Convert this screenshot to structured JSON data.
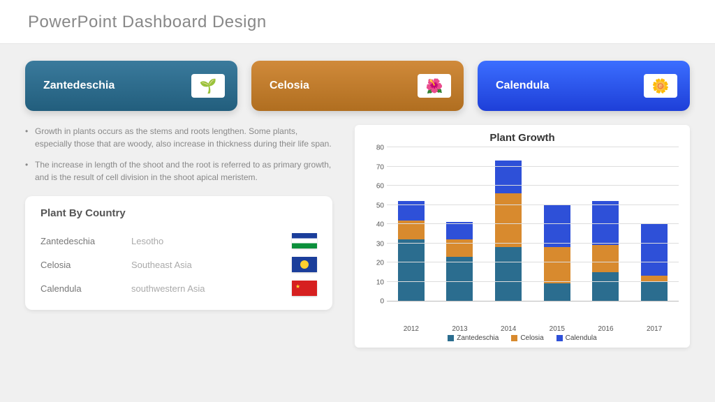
{
  "header": {
    "title": "PowerPoint Dashboard Design"
  },
  "cards": [
    {
      "label": "Zantedeschia",
      "icon": "🌱"
    },
    {
      "label": "Celosia",
      "icon": "🌺"
    },
    {
      "label": "Calendula",
      "icon": "🌼"
    }
  ],
  "bullets": [
    "Growth in plants occurs as the stems and roots lengthen. Some plants, especially those that are woody, also increase in thickness during their life span.",
    "The increase in length of the shoot and the root is referred to as primary growth, and is the result of cell division in the shoot apical meristem."
  ],
  "country_box": {
    "title": "Plant By Country",
    "rows": [
      {
        "plant": "Zantedeschia",
        "region": "Lesotho"
      },
      {
        "plant": "Celosia",
        "region": "Southeast Asia"
      },
      {
        "plant": "Calendula",
        "region": "southwestern Asia"
      }
    ]
  },
  "chart_data": {
    "type": "bar",
    "title": "Plant Growth",
    "categories": [
      "2012",
      "2013",
      "2014",
      "2015",
      "2016",
      "2017"
    ],
    "series": [
      {
        "name": "Zantedeschia",
        "color": "#2b6d8f",
        "values": [
          32,
          23,
          28,
          9,
          15,
          10
        ]
      },
      {
        "name": "Celosia",
        "color": "#d88a2e",
        "values": [
          10,
          9,
          28,
          19,
          14,
          3
        ]
      },
      {
        "name": "Calendula",
        "color": "#2e50d8",
        "values": [
          10,
          9,
          17,
          22,
          23,
          27
        ]
      }
    ],
    "xlabel": "",
    "ylabel": "",
    "ylim": [
      0,
      80
    ],
    "y_ticks": [
      0,
      10,
      20,
      30,
      40,
      50,
      60,
      70,
      80
    ]
  }
}
